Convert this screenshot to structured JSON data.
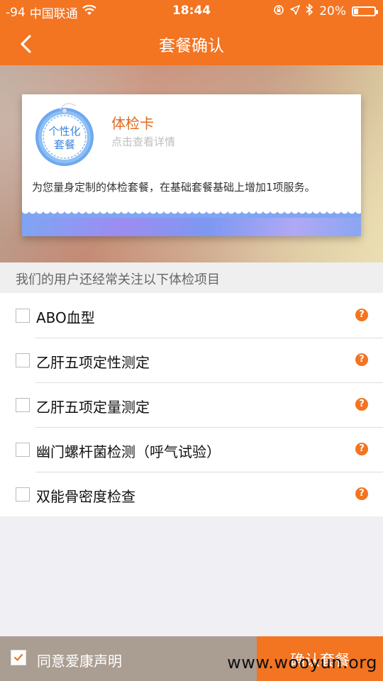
{
  "status": {
    "signal": "-94",
    "carrier": "中国联通",
    "time": "18:44",
    "battery": "20%",
    "battery_level": 0.2
  },
  "nav": {
    "title": "套餐确认"
  },
  "card": {
    "badge_line1": "个性化",
    "badge_line2": "套餐",
    "title": "体检卡",
    "subtitle": "点击查看详情",
    "description": "为您量身定制的体检套餐，在基础套餐基础上增加1项服务。"
  },
  "section": {
    "header": "我们的用户还经常关注以下体检项目"
  },
  "items": [
    {
      "label": "ABO血型",
      "help": "?"
    },
    {
      "label": "乙肝五项定性测定",
      "help": "?"
    },
    {
      "label": "乙肝五项定量测定",
      "help": "?"
    },
    {
      "label": "幽门螺杆菌检测（呼气试验）",
      "help": "?"
    },
    {
      "label": "双能骨密度检查",
      "help": "?"
    }
  ],
  "bottom": {
    "agree_label": "同意爱康声明",
    "confirm_label": "确认套餐"
  },
  "watermark": "www.wooyun.org",
  "colors": {
    "accent": "#f37421",
    "bottom_left": "#aa9d92"
  }
}
